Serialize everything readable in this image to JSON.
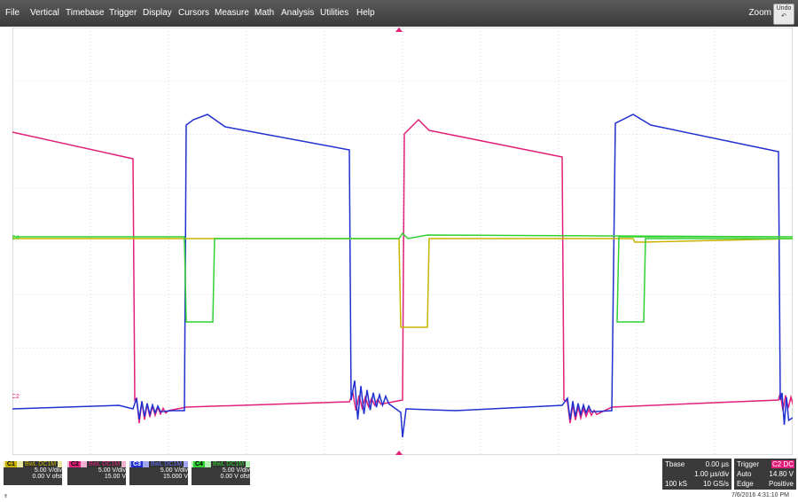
{
  "menu": [
    "File",
    "Vertical",
    "Timebase",
    "Trigger",
    "Display",
    "Cursors",
    "Measure",
    "Math",
    "Analysis",
    "Utilities",
    "Help"
  ],
  "zoom_label": "Zoom",
  "undo_label": "Undo",
  "trace_labels": {
    "c2": "C2",
    "c4": "C4"
  },
  "channels": [
    {
      "num": "C1",
      "coupling": "BwL DC1M",
      "scale": "5.00 V/div",
      "offset": "0.00 V ofst",
      "color": "#c8b400"
    },
    {
      "num": "C2",
      "coupling": "BwL DC1M",
      "scale": "5.00 V/div",
      "offset": "15.00 V",
      "color": "#e0207a"
    },
    {
      "num": "C3",
      "coupling": "BwL DC1M",
      "scale": "5.00 V/div",
      "offset": "15.000 V",
      "color": "#2030d0"
    },
    {
      "num": "C4",
      "coupling": "BwL DC1M",
      "scale": "5.00 V/div",
      "offset": "0.00 V ofst",
      "color": "#30d030"
    }
  ],
  "timebase": {
    "label": "Tbase",
    "delay": "0.00 µs",
    "per_div": "1.00 µs/div",
    "samples": "100 kS",
    "rate": "10 GS/s"
  },
  "trigger": {
    "label": "Trigger",
    "source": "C2 DC",
    "mode": "Auto",
    "level": "14.80 V",
    "type": "Edge",
    "slope": "Positive"
  },
  "timestamp": "7/6/2016 4:31:10 PM",
  "colors": {
    "c1": "#c8b400",
    "c2": "#e0207a",
    "c3": "#2030d0",
    "c4": "#30d030",
    "grid": "#d8d8d8"
  }
}
